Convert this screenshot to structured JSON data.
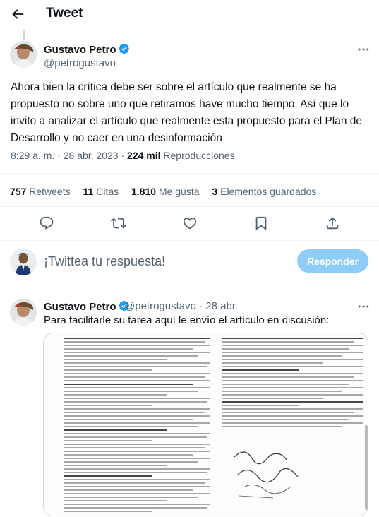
{
  "header": {
    "title": "Tweet"
  },
  "tweet": {
    "author_name": "Gustavo Petro",
    "author_handle": "@petrogustavo",
    "text": "Ahora bien la crítica debe ser sobre el artículo que realmente se ha propuesto no sobre uno que retiramos have mucho tiempo. Así que lo invito a analizar el artículo que realmente esta propuesto para el Plan de Desarrollo y no caer en una desinformación",
    "time": "8:29 a. m.",
    "date": "28 abr. 2023",
    "views_count": "224 mil",
    "views_label": "Reproducciones",
    "separator": "·"
  },
  "stats": {
    "retweets_count": "757",
    "retweets_label": "Retweets",
    "quotes_count": "11",
    "quotes_label": "Citas",
    "likes_count": "1.810",
    "likes_label": "Me gusta",
    "bookmarks_count": "3",
    "bookmarks_label": "Elementos guardados"
  },
  "compose": {
    "placeholder": "¡Twittea tu respuesta!",
    "button_label": "Responder"
  },
  "reply": {
    "author_name": "Gustavo Petro",
    "author_handle": "@petrogustavo",
    "separator": "·",
    "date": "28 abr.",
    "text": "Para facilitarle su tarea aquí le envío el artículo en discusión:"
  },
  "icons": {
    "back": "arrow-left-icon",
    "verified": "verified-badge-icon",
    "more": "more-dots-icon",
    "reply": "reply-icon",
    "retweet": "retweet-icon",
    "like": "heart-icon",
    "bookmark": "bookmark-icon",
    "share": "share-icon"
  },
  "colors": {
    "accent": "#1d9bf0",
    "reply_button": "#8ecdf8",
    "muted_text": "#536471"
  }
}
